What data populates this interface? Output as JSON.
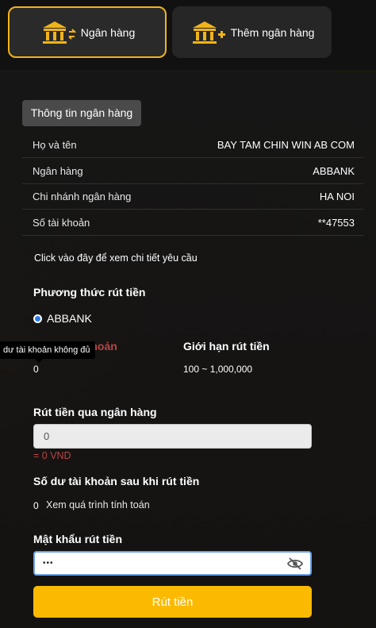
{
  "tabs": [
    {
      "label": "Ngân hàng",
      "icon": "bank-transfer-icon",
      "active": true
    },
    {
      "label": "Thêm ngân hàng",
      "icon": "bank-add-icon",
      "active": false
    }
  ],
  "bank_info": {
    "header": "Thông tin ngân hàng",
    "rows": [
      {
        "label": "Họ và tên",
        "value": "BAY TAM CHIN WIN AB COM"
      },
      {
        "label": "Ngân hàng",
        "value": "ABBANK"
      },
      {
        "label": "Chi nhánh ngân hàng",
        "value": "HA NOI"
      },
      {
        "label": "Số tài khoản",
        "value": "**47553"
      }
    ]
  },
  "details_link": "Click vào đây để xem chi tiết yêu cầu",
  "withdraw_method": {
    "title": "Phương thức rút tiền",
    "option": "ABBANK"
  },
  "balance": {
    "label": "Số dư tài khoản",
    "value": "0",
    "tooltip": "dư tài khoản không đủ"
  },
  "limit": {
    "label": "Giới hạn rút tiền",
    "value": "100 ~ 1,000,000"
  },
  "amount": {
    "label": "Rút tiền qua ngân hàng",
    "placeholder": "0",
    "converted": "= 0 VND"
  },
  "after_balance": {
    "label": "Số dư tài khoản sau khi rút tiền",
    "value": "0",
    "link": "Xem quá trình tính toán"
  },
  "password": {
    "label": "Mật khẩu rút tiền",
    "value": "•••"
  },
  "submit_label": "Rút tiền",
  "colors": {
    "accent": "#fbba00",
    "error": "#b64646",
    "focus": "#6aa1e8"
  }
}
